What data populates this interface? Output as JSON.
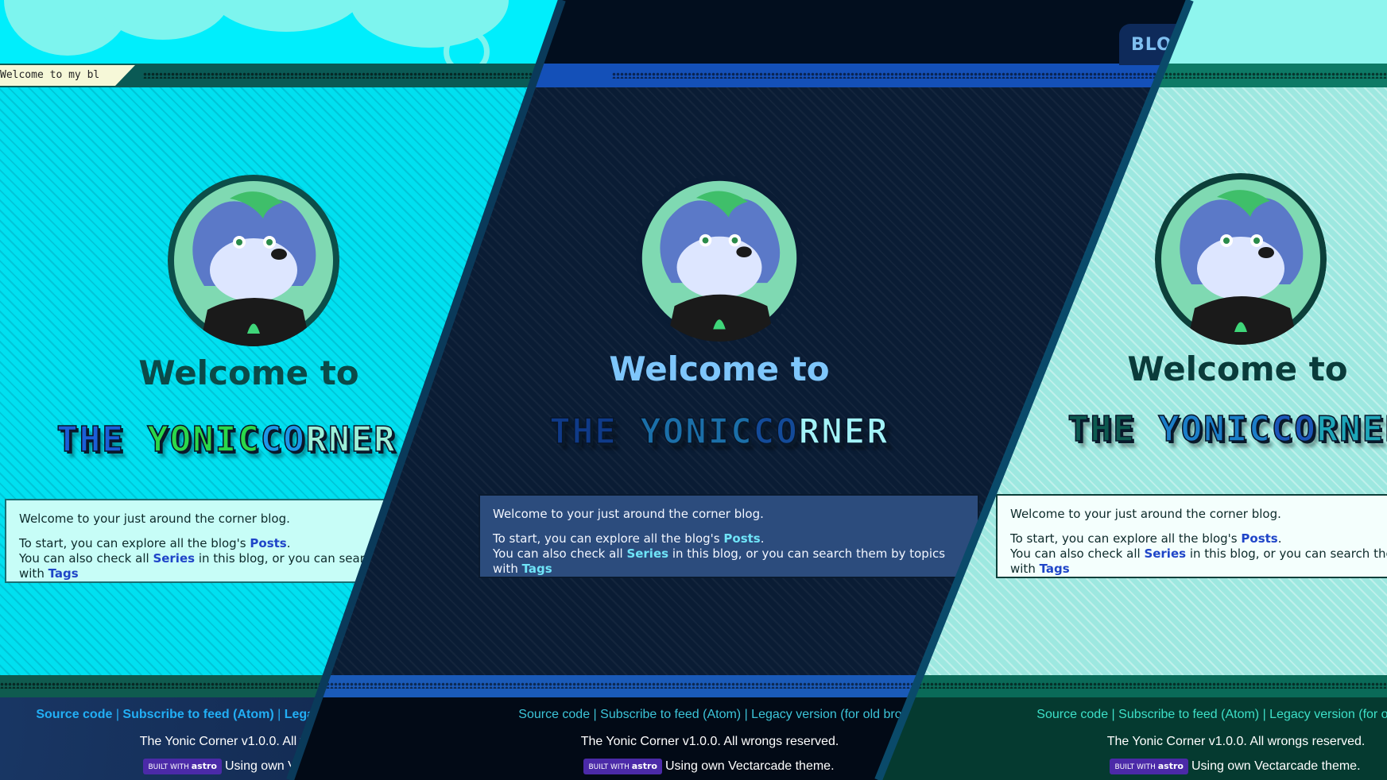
{
  "theme_names": [
    "cyan",
    "dark",
    "mint"
  ],
  "colors": {
    "cyan_bg": "#00e0f0",
    "dark_bg": "#0a1c34",
    "mint_bg": "#9de8e0",
    "link_blue": "#1f45c8",
    "astro_badge": "#4b2aa8"
  },
  "marquee": {
    "text": "Welcome to my bl"
  },
  "nav": {
    "blog_tab": "BLO"
  },
  "hero": {
    "avatar_alt": "avatar",
    "welcome_text": "Welcome to",
    "logo_word1": "THE",
    "logo_word2": "YONIC",
    "logo_word3": "CO",
    "logo_word4": "RNER"
  },
  "intro": {
    "line1": "Welcome to your just around the corner blog.",
    "line2_prefix": "To start, you can explore all the blog's ",
    "posts_link": "Posts",
    "line2_suffix": ".",
    "line3_prefix": "You can also check all ",
    "series_link": "Series",
    "line3_middle": " in this blog, or you can search them by topics with ",
    "tags_link": "Tags"
  },
  "footer": {
    "source_code": "Source code",
    "separator": " | ",
    "subscribe": "Subscribe to feed (Atom)",
    "legacy": "Legacy version (for old browsers)",
    "copyright": "The Yonic Corner v1.0.0. All wrongs reserved.",
    "badge_built_with": "BUILT WITH",
    "badge_astro": "astro",
    "theme_note": "Using own Vectarcade theme."
  }
}
